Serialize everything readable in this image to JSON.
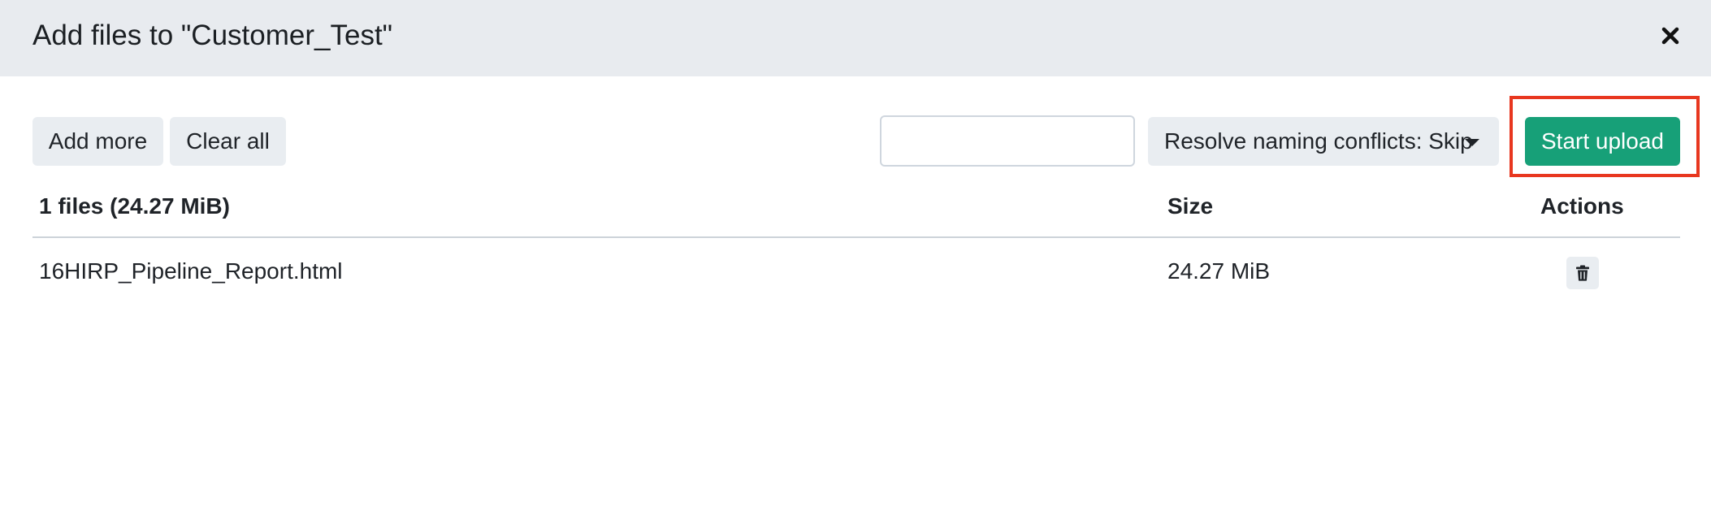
{
  "dialog": {
    "title": "Add files to \"Customer_Test\"",
    "close_icon": "close-icon"
  },
  "toolbar": {
    "add_more_label": "Add more",
    "clear_all_label": "Clear all",
    "filter_value": "",
    "resolve_label": "Resolve naming conflicts: Skip",
    "resolve_icon": "chevron-down-icon",
    "start_upload_label": "Start upload"
  },
  "table": {
    "headers": {
      "files": "1 files (24.27 MiB)",
      "size": "Size",
      "actions": "Actions"
    },
    "rows": [
      {
        "name": "16HIRP_Pipeline_Report.html",
        "size": "24.27 MiB",
        "action_icon": "trash-icon"
      }
    ]
  },
  "colors": {
    "header_bg": "#e8ebef",
    "button_bg": "#e9edf1",
    "primary": "#17a078",
    "highlight": "#e8371f"
  }
}
